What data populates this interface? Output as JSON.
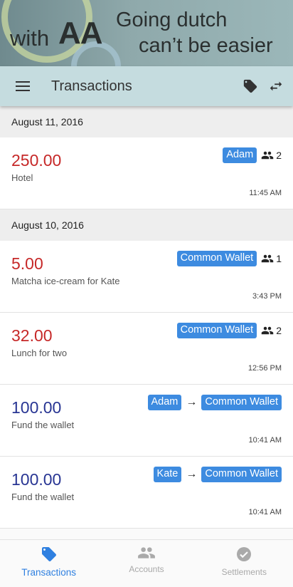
{
  "banner": {
    "with": "with",
    "aa": "AA",
    "line1": "Going dutch",
    "line2": "can’t be easier"
  },
  "appbar": {
    "title": "Transactions"
  },
  "colors": {
    "accent": "#2f80e0",
    "chip": "#3d8be0",
    "expense": "#c62828",
    "income": "#283593"
  },
  "groups": [
    {
      "date": "August 11, 2016",
      "items": [
        {
          "amount": "250.00",
          "desc": "Hotel",
          "time": "11:45 AM",
          "chip": "Adam",
          "count": "2"
        }
      ]
    },
    {
      "date": "August 10, 2016",
      "items": [
        {
          "amount": "5.00",
          "desc": "Matcha ice-cream for Kate",
          "time": "3:43 PM",
          "chip": "Common Wallet",
          "count": "1"
        },
        {
          "amount": "32.00",
          "desc": "Lunch for two",
          "time": "12:56 PM",
          "chip": "Common Wallet",
          "count": "2"
        },
        {
          "amount": "100.00",
          "desc": "Fund the wallet",
          "time": "10:41 AM",
          "from": "Adam",
          "to": "Common Wallet"
        },
        {
          "amount": "100.00",
          "desc": "Fund the wallet",
          "time": "10:41 AM",
          "from": "Kate",
          "to": "Common Wallet"
        }
      ]
    }
  ],
  "nav": {
    "transactions": "Transactions",
    "accounts": "Accounts",
    "settlements": "Settlements"
  }
}
